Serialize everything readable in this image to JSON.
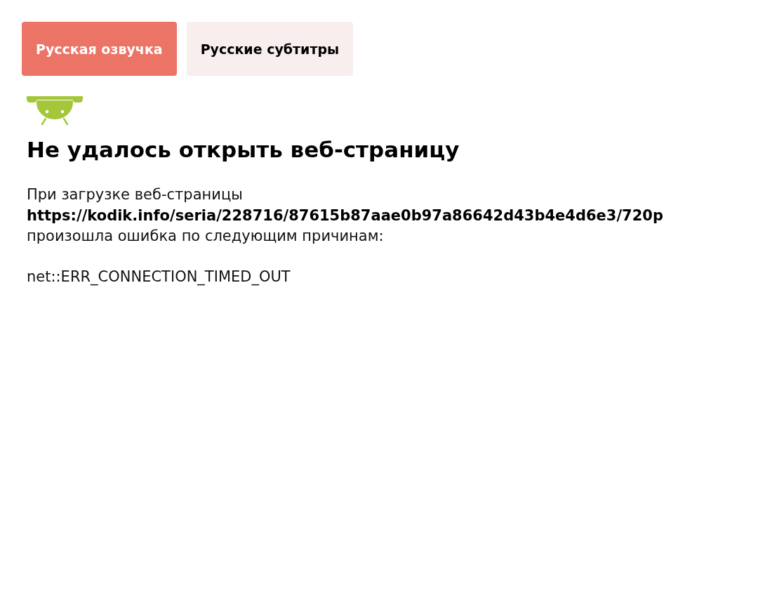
{
  "tabs": [
    {
      "label": "Русская озвучка",
      "selected": true
    },
    {
      "label": "Русские субтитры",
      "selected": false
    }
  ],
  "error": {
    "title": "Не удалось открыть веб-страницу",
    "message": "При загрузке веб-страницы **https://kodik.info/seria/228716/87615b87aae0b97a86642d43b4e4d6e3/720p** произошла ошибка по следующим причинам:",
    "code": "net::ERR_CONNECTION_TIMED_OUT"
  }
}
